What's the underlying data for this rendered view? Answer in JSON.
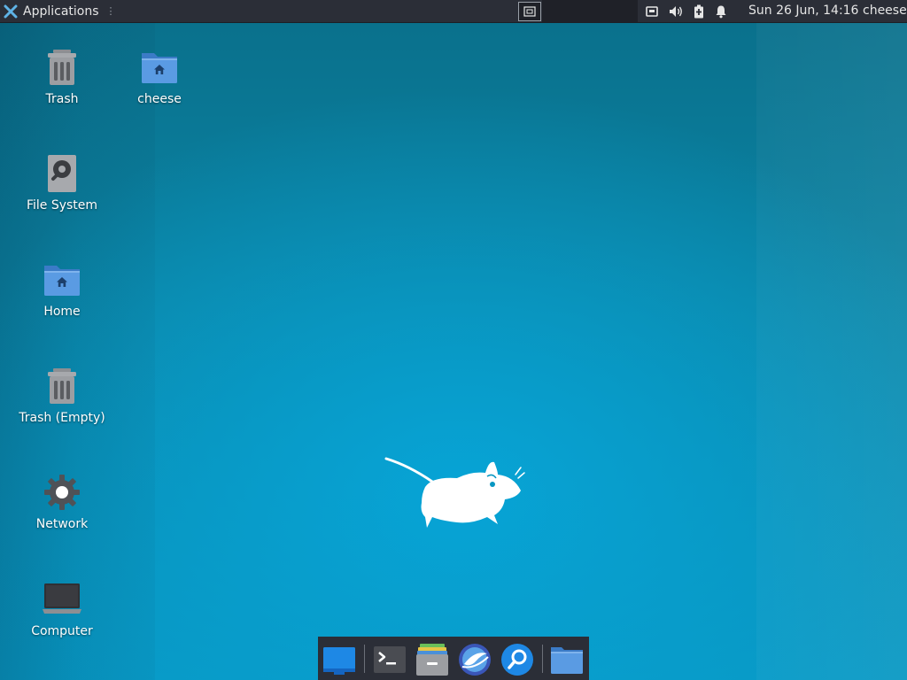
{
  "panel": {
    "applications_label": "Applications",
    "clock": "Sun 26 Jun, 14:16",
    "user": "cheese",
    "tray_icons": [
      "network-icon",
      "volume-icon",
      "battery-icon",
      "notification-bell-icon"
    ]
  },
  "desktop": {
    "icons": [
      {
        "label": "Trash",
        "icon": "trash-icon"
      },
      {
        "label": "cheese",
        "icon": "home-folder-icon"
      },
      {
        "label": "File System",
        "icon": "harddrive-icon"
      },
      {
        "label": "Home",
        "icon": "home-folder-icon"
      },
      {
        "label": "Trash (Empty)",
        "icon": "trash-icon"
      },
      {
        "label": "Network",
        "icon": "network-gear-icon"
      },
      {
        "label": "Computer",
        "icon": "computer-icon"
      }
    ]
  },
  "dock": {
    "items": [
      "show-desktop-icon",
      "terminal-icon",
      "file-manager-icon",
      "web-browser-icon",
      "app-finder-icon",
      "folder-icon"
    ]
  },
  "colors": {
    "panel_bg": "#2b2e37",
    "desktop_accent": "#0897c2",
    "folder_blue": "#4a90d9",
    "dock_blue": "#1e88e5"
  }
}
